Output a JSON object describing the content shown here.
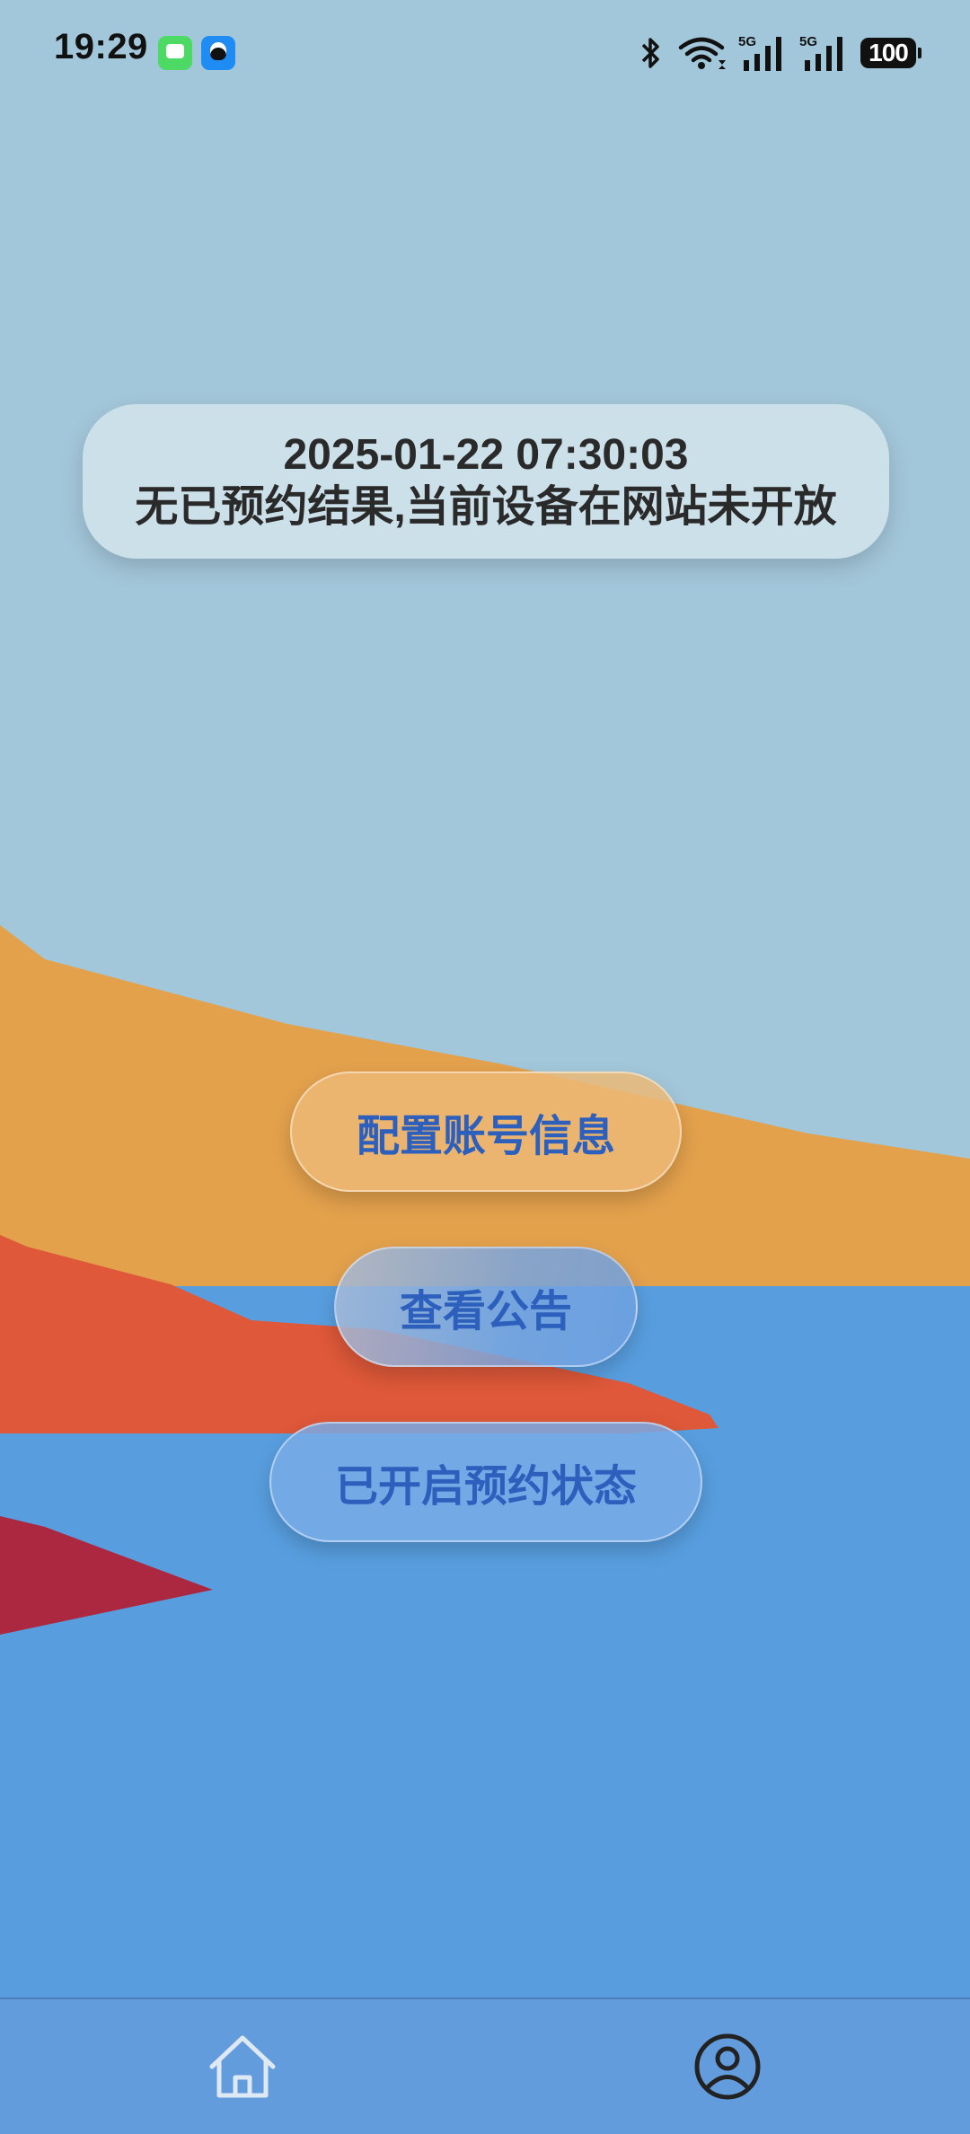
{
  "status_bar": {
    "time": "19:29",
    "notification_icons": [
      "messages-icon",
      "qq-icon"
    ],
    "system_icons": [
      "bluetooth-icon",
      "wifi-icon",
      "signal-5g-icon",
      "signal-5g-icon"
    ],
    "signal_label_1": "5G",
    "signal_label_2": "5G",
    "battery": "100"
  },
  "info_card": {
    "datetime": "2025-01-22 07:30:03",
    "status": "无已预约结果,当前设备在网站未开放"
  },
  "actions": {
    "config_label": "配置账号信息",
    "notice_label": "查看公告",
    "reserve_label": "已开启预约状态"
  },
  "bottom_nav": {
    "items": [
      {
        "icon": "home-icon"
      },
      {
        "icon": "profile-icon"
      }
    ]
  },
  "colors": {
    "sky": "#a3c7da",
    "water": "#589edf",
    "sand": "#e3a14c",
    "red_ridge": "#de5839",
    "crimson_ridge": "#ab2840",
    "nav_bg": "#639cdc",
    "button_text": "#2d5fbd"
  }
}
